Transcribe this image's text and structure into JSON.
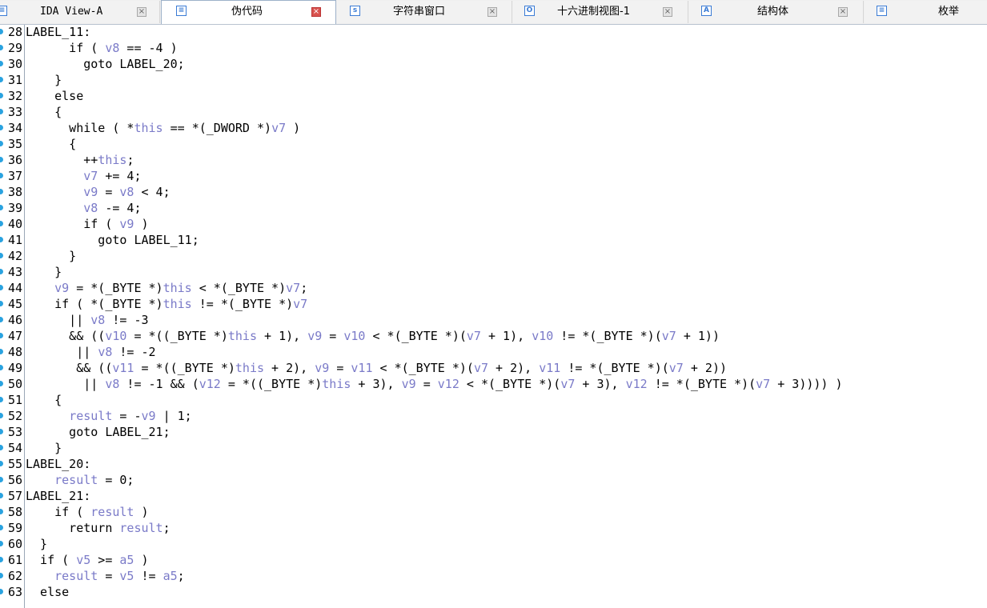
{
  "tabs": [
    {
      "label": "IDA View-A",
      "icon": "disasm-icon",
      "active": false
    },
    {
      "label": "伪代码",
      "icon": "pseudocode-icon",
      "active": true
    },
    {
      "label": "字符串窗口",
      "icon": "strings-icon",
      "active": false
    },
    {
      "label": "十六进制视图-1",
      "icon": "hex-icon",
      "active": false
    },
    {
      "label": "结构体",
      "icon": "struct-icon",
      "active": false
    },
    {
      "label": "枚举",
      "icon": "enum-icon",
      "active": false
    }
  ],
  "colors": {
    "variable": "#7a7ac8",
    "text": "#000000",
    "breakpoint": "#2aa3e0",
    "gutter_line": "#9aa7b6",
    "active_tab": "#ffffff",
    "close_active": "#d9534f"
  },
  "code_lines": [
    {
      "n": "28",
      "text": "LABEL_11:"
    },
    {
      "n": "29",
      "text": "      if ( v8 == -4 )"
    },
    {
      "n": "30",
      "text": "        goto LABEL_20;"
    },
    {
      "n": "31",
      "text": "    }"
    },
    {
      "n": "32",
      "text": "    else"
    },
    {
      "n": "33",
      "text": "    {"
    },
    {
      "n": "34",
      "text": "      while ( *this == *(_DWORD *)v7 )"
    },
    {
      "n": "35",
      "text": "      {"
    },
    {
      "n": "36",
      "text": "        ++this;"
    },
    {
      "n": "37",
      "text": "        v7 += 4;"
    },
    {
      "n": "38",
      "text": "        v9 = v8 < 4;"
    },
    {
      "n": "39",
      "text": "        v8 -= 4;"
    },
    {
      "n": "40",
      "text": "        if ( v9 )"
    },
    {
      "n": "41",
      "text": "          goto LABEL_11;"
    },
    {
      "n": "42",
      "text": "      }"
    },
    {
      "n": "43",
      "text": "    }"
    },
    {
      "n": "44",
      "text": "    v9 = *(_BYTE *)this < *(_BYTE *)v7;"
    },
    {
      "n": "45",
      "text": "    if ( *(_BYTE *)this != *(_BYTE *)v7"
    },
    {
      "n": "46",
      "text": "      || v8 != -3"
    },
    {
      "n": "47",
      "text": "      && ((v10 = *((_BYTE *)this + 1), v9 = v10 < *(_BYTE *)(v7 + 1), v10 != *(_BYTE *)(v7 + 1))"
    },
    {
      "n": "48",
      "text": "       || v8 != -2"
    },
    {
      "n": "49",
      "text": "       && ((v11 = *((_BYTE *)this + 2), v9 = v11 < *(_BYTE *)(v7 + 2), v11 != *(_BYTE *)(v7 + 2))"
    },
    {
      "n": "50",
      "text": "        || v8 != -1 && (v12 = *((_BYTE *)this + 3), v9 = v12 < *(_BYTE *)(v7 + 3), v12 != *(_BYTE *)(v7 + 3)))) )"
    },
    {
      "n": "51",
      "text": "    {"
    },
    {
      "n": "52",
      "text": "      result = -v9 | 1;"
    },
    {
      "n": "53",
      "text": "      goto LABEL_21;"
    },
    {
      "n": "54",
      "text": "    }"
    },
    {
      "n": "55",
      "text": "LABEL_20:"
    },
    {
      "n": "56",
      "text": "    result = 0;"
    },
    {
      "n": "57",
      "text": "LABEL_21:"
    },
    {
      "n": "58",
      "text": "    if ( result )"
    },
    {
      "n": "59",
      "text": "      return result;"
    },
    {
      "n": "60",
      "text": "  }"
    },
    {
      "n": "61",
      "text": "  if ( v5 >= a5 )"
    },
    {
      "n": "62",
      "text": "    result = v5 != a5;"
    },
    {
      "n": "63",
      "text": "  else"
    }
  ]
}
